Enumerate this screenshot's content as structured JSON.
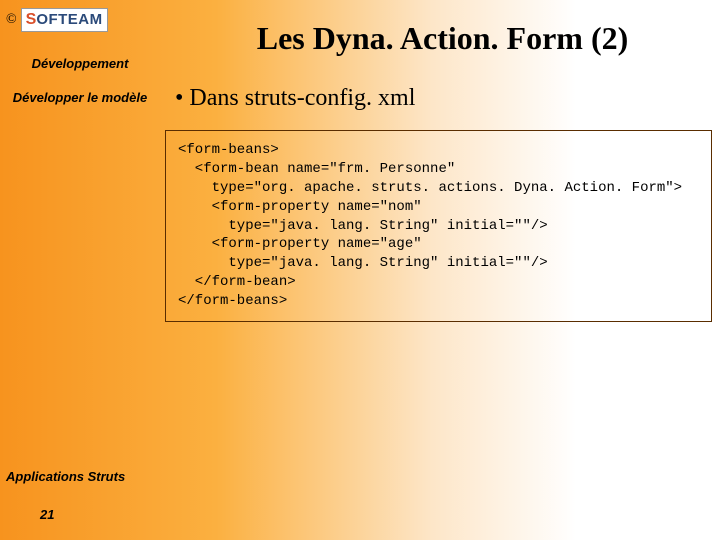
{
  "logo": {
    "copyright": "©",
    "first": "S",
    "rest": "OFTEAM"
  },
  "sidebar": {
    "section1": "Développement",
    "section2": "Développer le modèle"
  },
  "title": "Les Dyna. Action. Form (2)",
  "bullet": "•  Dans struts-config. xml",
  "code": "<form-beans>\n  <form-bean name=\"frm. Personne\"\n    type=\"org. apache. struts. actions. Dyna. Action. Form\">\n    <form-property name=\"nom\"\n      type=\"java. lang. String\" initial=\"\"/>\n    <form-property name=\"age\"\n      type=\"java. lang. String\" initial=\"\"/>\n  </form-bean>\n</form-beans>",
  "footer": "Applications Struts",
  "page": "21"
}
